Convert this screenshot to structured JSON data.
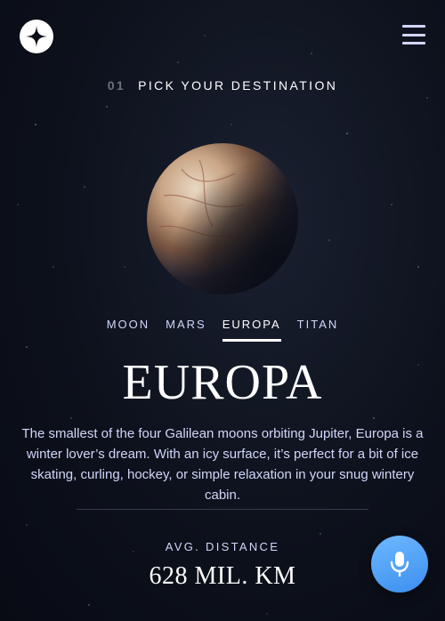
{
  "header": {
    "logo_icon": "star-logo-icon",
    "menu_icon": "hamburger-menu-icon"
  },
  "eyebrow": {
    "number": "01",
    "text": "PICK YOUR DESTINATION"
  },
  "planet": {
    "name": "europa-image"
  },
  "tabs": [
    {
      "label": "MOON",
      "active": false
    },
    {
      "label": "MARS",
      "active": false
    },
    {
      "label": "EUROPA",
      "active": true
    },
    {
      "label": "TITAN",
      "active": false
    }
  ],
  "destination": {
    "title": "EUROPA",
    "description": "The smallest of the four Galilean moons orbiting Jupiter, Europa is a winter lover’s dream. With an icy surface, it’s perfect for a bit of ice skating, curling, hockey, or simple relaxation in your snug wintery cabin.",
    "stat_label": "AVG. DISTANCE",
    "stat_value": "628 MIL. KM"
  },
  "mic_button": {
    "icon": "microphone-icon"
  },
  "colors": {
    "accent": "#d0d6f9",
    "background": "#0d111c",
    "mic": "#4a9cf5"
  }
}
